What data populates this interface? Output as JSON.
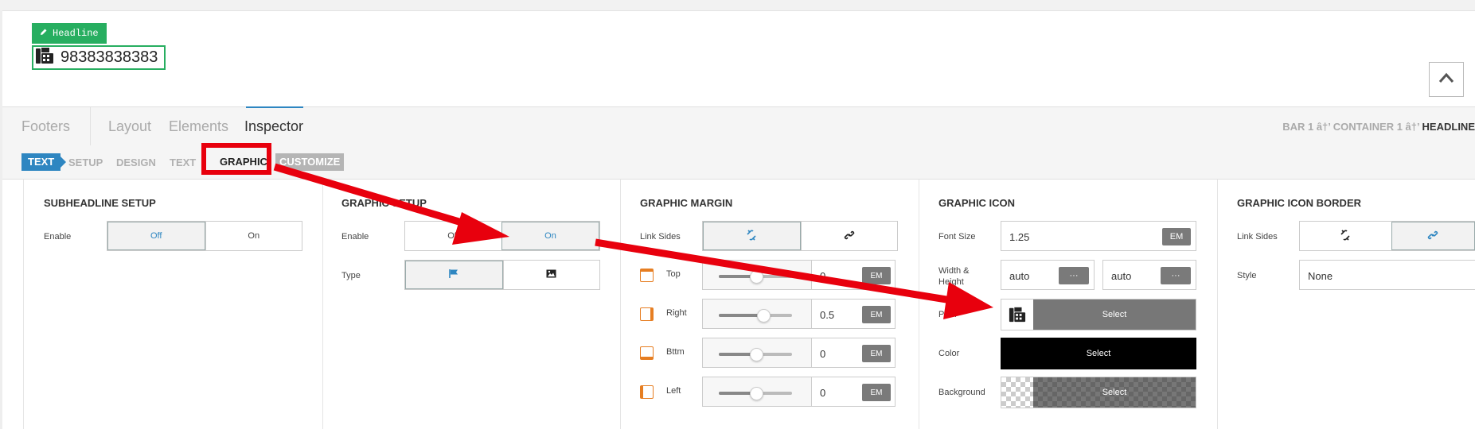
{
  "preview": {
    "tag_label": "Headline",
    "phone_number": "98383838383"
  },
  "tabs": [
    {
      "label": "Footers"
    },
    {
      "label": "Layout"
    },
    {
      "label": "Elements"
    },
    {
      "label": "Inspector"
    }
  ],
  "breadcrumb": {
    "path": "BAR 1 â†’ CONTAINER 1 â†’",
    "current": "HEADLINE"
  },
  "subtabs": {
    "active": "TEXT",
    "setup": "SETUP",
    "design": "DESIGN",
    "text": "TEXT",
    "graphic": "GRAPHIC",
    "customize": "CUSTOMIZE"
  },
  "subheadline_setup": {
    "title": "SUBHEADLINE SETUP",
    "enable_label": "Enable",
    "off": "Off",
    "on": "On"
  },
  "graphic_setup": {
    "title": "GRAPHIC SETUP",
    "enable_label": "Enable",
    "off": "Off",
    "on": "On",
    "type_label": "Type"
  },
  "graphic_margin": {
    "title": "GRAPHIC MARGIN",
    "link_label": "Link Sides",
    "rows": [
      {
        "label": "Top",
        "value": "0",
        "unit": "EM",
        "slider": 0.5
      },
      {
        "label": "Right",
        "value": "0.5",
        "unit": "EM",
        "slider": 0.6
      },
      {
        "label": "Bttm",
        "value": "0",
        "unit": "EM",
        "slider": 0.5
      },
      {
        "label": "Left",
        "value": "0",
        "unit": "EM",
        "slider": 0.5
      }
    ]
  },
  "graphic_icon": {
    "title": "GRAPHIC ICON",
    "font_size_label": "Font Size",
    "font_size_value": "1.25",
    "font_size_unit": "EM",
    "wh_label_1": "Width &",
    "wh_label_2": "Height",
    "width_value": "auto",
    "height_value": "auto",
    "dots": "···",
    "primary_label": "Prim",
    "select": "Select",
    "color_label": "Color",
    "background_label": "Background"
  },
  "graphic_icon_border": {
    "title": "GRAPHIC ICON BORDER",
    "link_label": "Link Sides",
    "style_label": "Style",
    "style_value": "None"
  },
  "colors": {
    "accent": "#2e86c1",
    "green": "#27ae60",
    "annotation_red": "#e8000d",
    "margin_icon": "#e67e22"
  }
}
